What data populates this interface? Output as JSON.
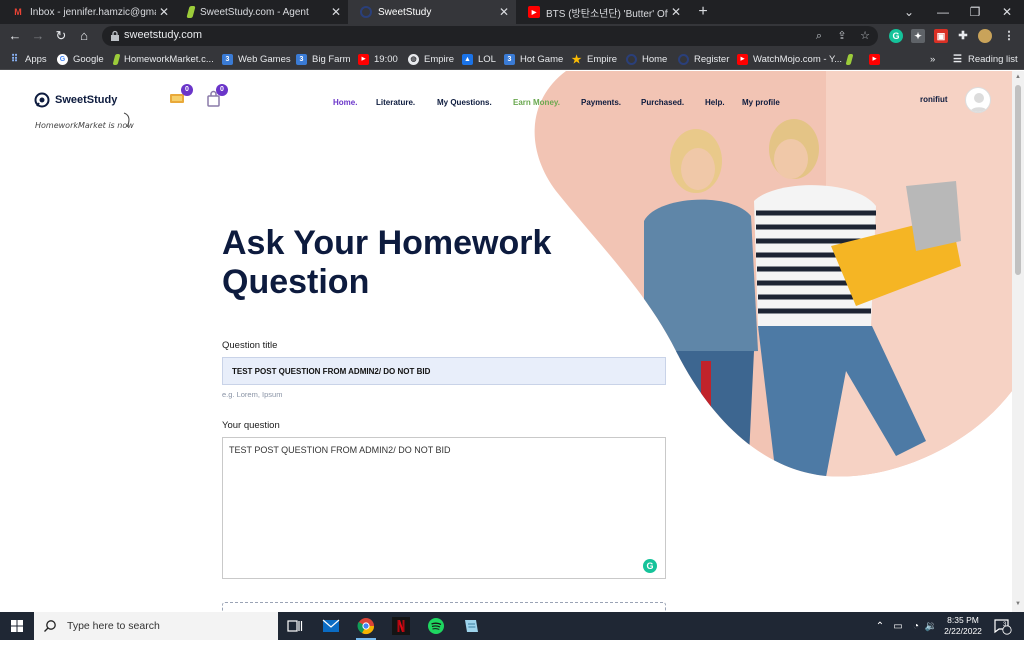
{
  "browser": {
    "tabs": [
      {
        "title": "Inbox - jennifer.hamzic@gmail.co",
        "favicon": "gmail-icon",
        "active": false
      },
      {
        "title": "SweetStudy.com - Agent",
        "favicon": "sweetstudy-icon",
        "active": false
      },
      {
        "title": "SweetStudy",
        "favicon": "sweetstudy-logo-icon",
        "active": true
      },
      {
        "title": "BTS (방탄소년단) 'Butter' Official",
        "favicon": "youtube-icon",
        "active": false
      }
    ],
    "url": "sweetstudy.com",
    "bookmarks": [
      {
        "label": "Apps"
      },
      {
        "label": "Google"
      },
      {
        "label": "HomeworkMarket.c..."
      },
      {
        "label": "Web Games"
      },
      {
        "label": "Big Farm"
      },
      {
        "label": "19:00"
      },
      {
        "label": "Empire"
      },
      {
        "label": "LOL"
      },
      {
        "label": "Hot Game"
      },
      {
        "label": "Empire"
      },
      {
        "label": "Home"
      },
      {
        "label": "Register"
      },
      {
        "label": "WatchMojo.com - Y..."
      }
    ],
    "reading_list": "Reading list",
    "more_bookmarks": "»"
  },
  "site": {
    "logo_name": "SweetStudy",
    "tagline": "HomeworkMarket is now",
    "badges": {
      "coins": "0",
      "notifications": "0"
    },
    "nav": [
      {
        "label": "Home.",
        "key": "home"
      },
      {
        "label": "Literature.",
        "key": "literature"
      },
      {
        "label": "My Questions.",
        "key": "my-questions"
      },
      {
        "label": "Earn Money.",
        "key": "earn"
      },
      {
        "label": "Payments.",
        "key": "payments"
      },
      {
        "label": "Purchased.",
        "key": "purchased"
      },
      {
        "label": "Help.",
        "key": "help"
      },
      {
        "label": "My profile",
        "key": "profile"
      }
    ],
    "username": "ronifiut",
    "colors": {
      "navy": "#0d1b3e",
      "purple": "#6a35c9",
      "green": "#6aa84f",
      "blob": "#f2c4b4"
    }
  },
  "form": {
    "heading_line1": "Ask Your Homework",
    "heading_line2": "Question",
    "title_label": "Question title",
    "title_value": "TEST POST QUESTION FROM ADMIN2/ DO NOT BID",
    "title_hint": "e.g. Lorem, Ipsum",
    "question_label": "Your question",
    "question_value": "TEST POST QUESTION FROM ADMIN2/ DO NOT BID"
  },
  "taskbar": {
    "search_placeholder": "Type here to search",
    "time": "8:35 PM",
    "date": "2/22/2022",
    "notifications": "3"
  }
}
